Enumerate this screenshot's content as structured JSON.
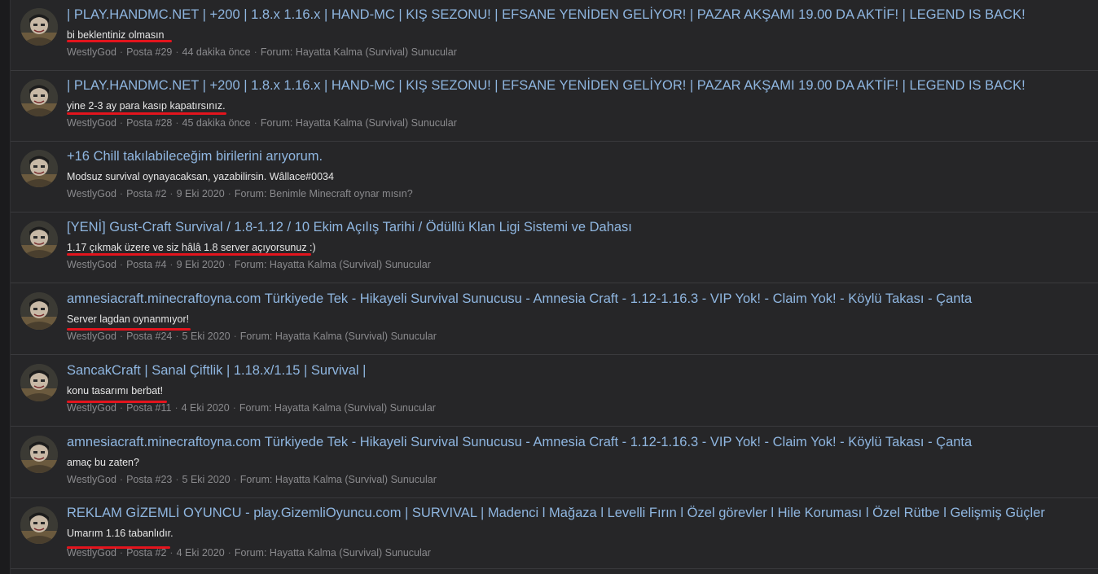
{
  "posts": [
    {
      "title": "| PLAY.HANDMC.NET | +200 | 1.8.x 1.16.x | HAND-MC | KIŞ SEZONU! | EFSANE YENİDEN GELİYOR! | PAZAR AKŞAMI 19.00 DA AKTİF! | LEGEND IS BACK!",
      "snippet": "bi beklentiniz olmasın",
      "author": "WestlyGod",
      "post_no": "Posta #29",
      "time": "44 dakika önce",
      "forum": "Forum: Hayatta Kalma (Survival) Sunucular"
    },
    {
      "title": "| PLAY.HANDMC.NET | +200 | 1.8.x 1.16.x | HAND-MC | KIŞ SEZONU! | EFSANE YENİDEN GELİYOR! | PAZAR AKŞAMI 19.00 DA AKTİF! | LEGEND IS BACK!",
      "snippet": "yine 2-3 ay para kasıp kapatırsınız.",
      "author": "WestlyGod",
      "post_no": "Posta #28",
      "time": "45 dakika önce",
      "forum": "Forum: Hayatta Kalma (Survival) Sunucular"
    },
    {
      "title": "+16 Chill takılabileceğim birilerini arıyorum.",
      "snippet": "Modsuz survival oynayacaksan, yazabilirsin. Wâllace#0034",
      "author": "WestlyGod",
      "post_no": "Posta #2",
      "time": "9 Eki 2020",
      "forum": "Forum: Benimle Minecraft oynar mısın?"
    },
    {
      "title": "[YENİ] Gust-Craft Survival / 1.8-1.12 / 10 Ekim Açılış Tarihi / Ödüllü Klan Ligi Sistemi ve Dahası",
      "snippet": "1.17 çıkmak üzere ve siz hâlâ 1.8 server açıyorsunuz :)",
      "author": "WestlyGod",
      "post_no": "Posta #4",
      "time": "9 Eki 2020",
      "forum": "Forum: Hayatta Kalma (Survival) Sunucular"
    },
    {
      "title": "amnesiacraft.minecraftoyna.com Türkiyede Tek - Hikayeli Survival Sunucusu - Amnesia Craft - 1.12-1.16.3 - VIP Yok! - Claim Yok! - Köylü Takası - Çanta",
      "snippet": "Server lagdan oynanmıyor!",
      "author": "WestlyGod",
      "post_no": "Posta #24",
      "time": "5 Eki 2020",
      "forum": "Forum: Hayatta Kalma (Survival) Sunucular"
    },
    {
      "title": "SancakCraft | Sanal Çiftlik | 1.18.x/1.15 | Survival |",
      "snippet": "konu tasarımı berbat!",
      "author": "WestlyGod",
      "post_no": "Posta #11",
      "time": "4 Eki 2020",
      "forum": "Forum: Hayatta Kalma (Survival) Sunucular"
    },
    {
      "title": "amnesiacraft.minecraftoyna.com Türkiyede Tek - Hikayeli Survival Sunucusu - Amnesia Craft - 1.12-1.16.3 - VIP Yok! - Claim Yok! - Köylü Takası - Çanta",
      "snippet": "amaç bu zaten?",
      "author": "WestlyGod",
      "post_no": "Posta #23",
      "time": "5 Eki 2020",
      "forum": "Forum: Hayatta Kalma (Survival) Sunucular"
    },
    {
      "title": "REKLAM GİZEMLİ OYUNCU - play.GizemliOyuncu.com | SURVIVAL | Madenci l Mağaza l Levelli Fırın l Özel görevler l Hile Koruması l Özel Rütbe l Gelişmiş Güçler",
      "snippet": "Umarım 1.16 tabanlıdır.",
      "author": "WestlyGod",
      "post_no": "Posta #2",
      "time": "4 Eki 2020",
      "forum": "Forum: Hayatta Kalma (Survival) Sunucular"
    }
  ]
}
